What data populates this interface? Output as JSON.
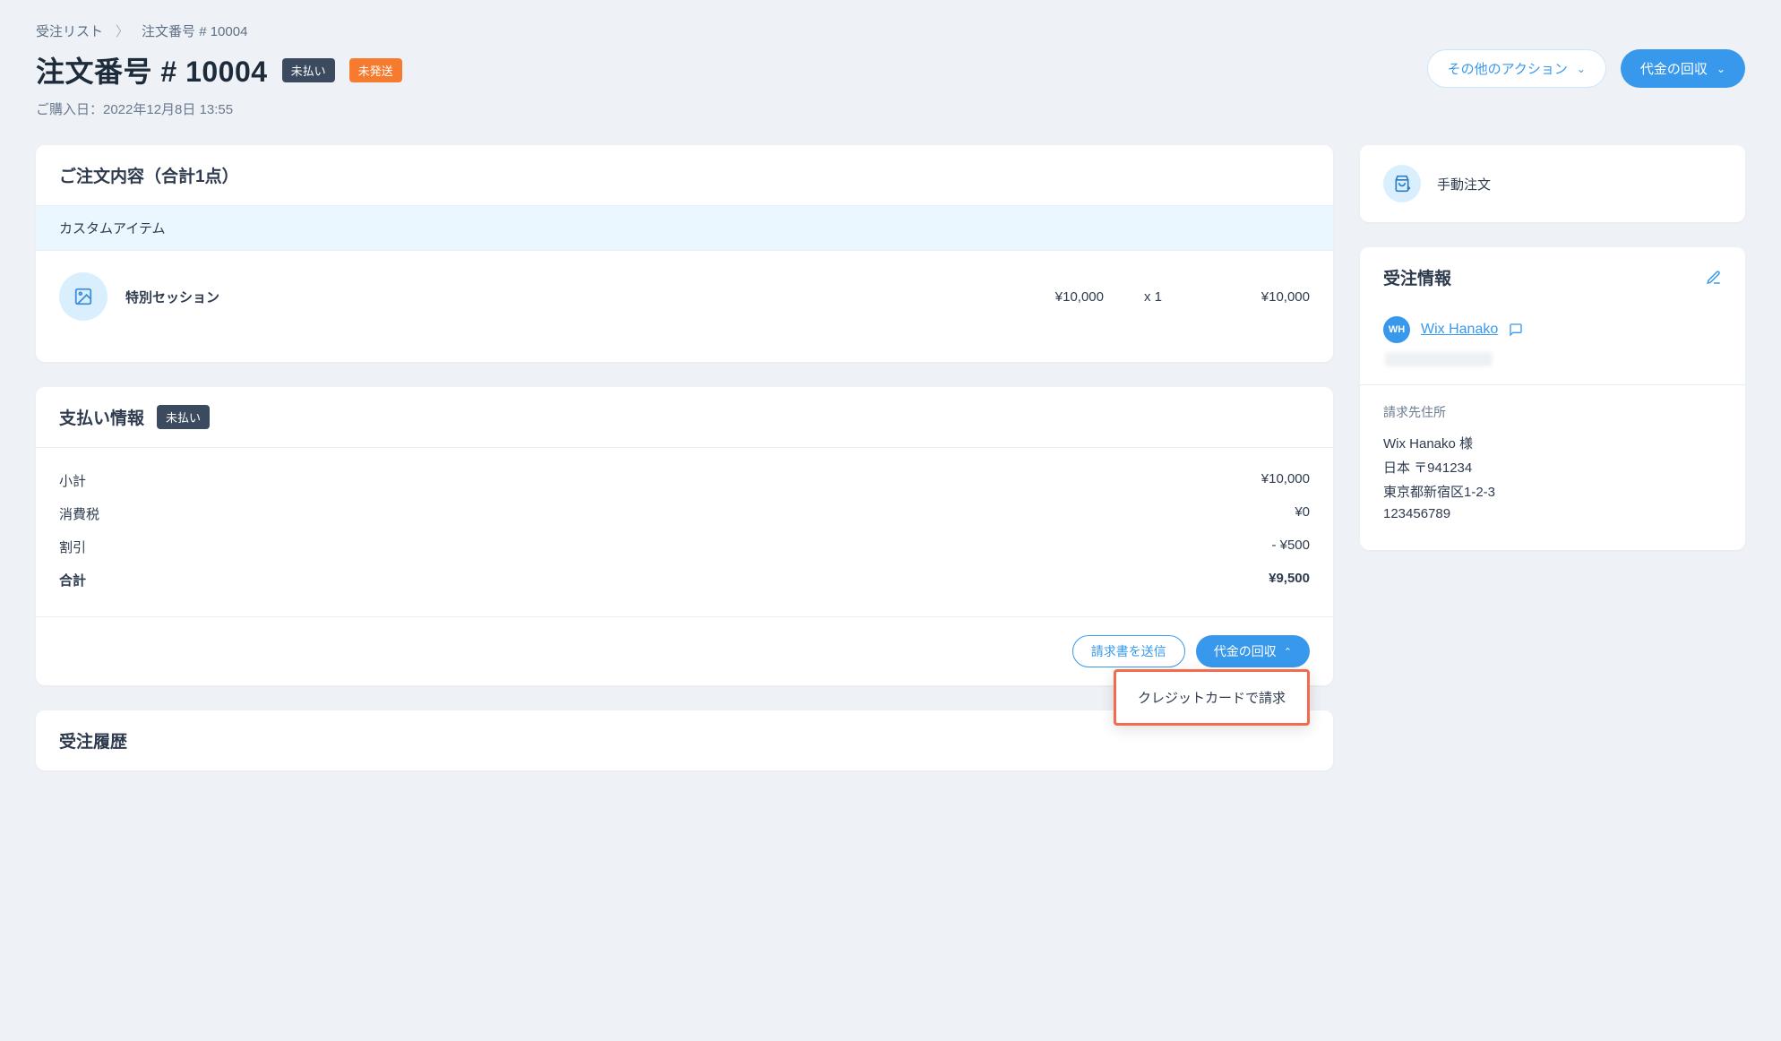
{
  "breadcrumb": {
    "root": "受注リスト",
    "current": "注文番号 # 10004"
  },
  "header": {
    "title": "注文番号 # 10004",
    "status_pay": "未払い",
    "status_ship": "未発送",
    "purchased_label": "ご購入日：2022年12月8日 13:55",
    "actions_label": "その他のアクション",
    "collect_label": "代金の回収"
  },
  "order": {
    "title": "ご注文内容（合計1点）",
    "custom_label": "カスタムアイテム",
    "item": {
      "name": "特別セッション",
      "unit_price": "¥10,000",
      "qty": "x 1",
      "line_total": "¥10,000"
    }
  },
  "payment": {
    "title": "支払い情報",
    "status": "未払い",
    "rows": {
      "subtotal_label": "小計",
      "subtotal_value": "¥10,000",
      "tax_label": "消費税",
      "tax_value": "¥0",
      "discount_label": "割引",
      "discount_value": "- ¥500",
      "total_label": "合計",
      "total_value": "¥9,500"
    },
    "invoice_btn": "請求書を送信",
    "collect_btn": "代金の回収",
    "dropdown": {
      "credit": "クレジットカードで請求"
    }
  },
  "history": {
    "title": "受注履歴"
  },
  "side": {
    "manual_label": "手動注文",
    "info_title": "受注情報",
    "customer": {
      "initials": "WH",
      "name": "Wix Hanako"
    },
    "billing": {
      "label": "請求先住所",
      "name": "Wix Hanako 様",
      "country": "日本 〒941234",
      "street": "東京都新宿区1-2-3",
      "phone": "123456789"
    }
  }
}
